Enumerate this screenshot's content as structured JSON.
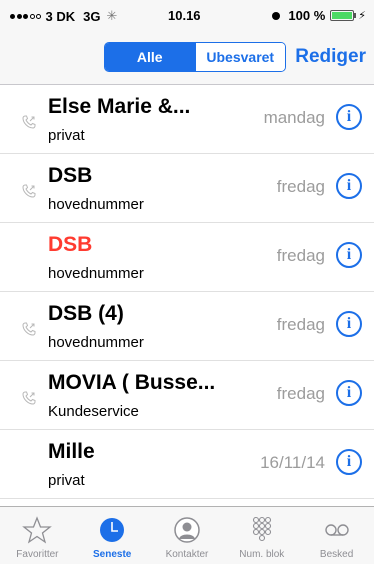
{
  "status_bar": {
    "carrier": "3 DK",
    "network": "3G",
    "time": "10.16",
    "battery": "100 %",
    "battery_level": 1.0
  },
  "nav": {
    "segments": [
      "Alle",
      "Ubesvaret"
    ],
    "selected_segment": "Alle",
    "edit_label": "Rediger"
  },
  "calls": [
    {
      "name": "Else Marie &...",
      "sub": "privat",
      "date": "mandag",
      "missed": false,
      "outgoing": true
    },
    {
      "name": "DSB",
      "sub": "hovednummer",
      "date": "fredag",
      "missed": false,
      "outgoing": true
    },
    {
      "name": "DSB",
      "sub": "hovednummer",
      "date": "fredag",
      "missed": true,
      "outgoing": false
    },
    {
      "name": "DSB  (4)",
      "sub": "hovednummer",
      "date": "fredag",
      "missed": false,
      "outgoing": true
    },
    {
      "name": "MOVIA ( Busse...",
      "sub": "Kundeservice",
      "date": "fredag",
      "missed": false,
      "outgoing": true
    },
    {
      "name": "Mille",
      "sub": "privat",
      "date": "16/11/14",
      "missed": false,
      "outgoing": false
    }
  ],
  "tabs": [
    {
      "label": "Favoritter",
      "icon": "star-icon",
      "active": false
    },
    {
      "label": "Seneste",
      "icon": "clock-icon",
      "active": true
    },
    {
      "label": "Kontakter",
      "icon": "contact-icon",
      "active": false
    },
    {
      "label": "Num. blok",
      "icon": "keypad-icon",
      "active": false
    },
    {
      "label": "Besked",
      "icon": "voicemail-icon",
      "active": false
    }
  ],
  "colors": {
    "accent": "#1c6fe8",
    "missed": "#ff3b30",
    "secondary_text": "#9c9c9c"
  }
}
